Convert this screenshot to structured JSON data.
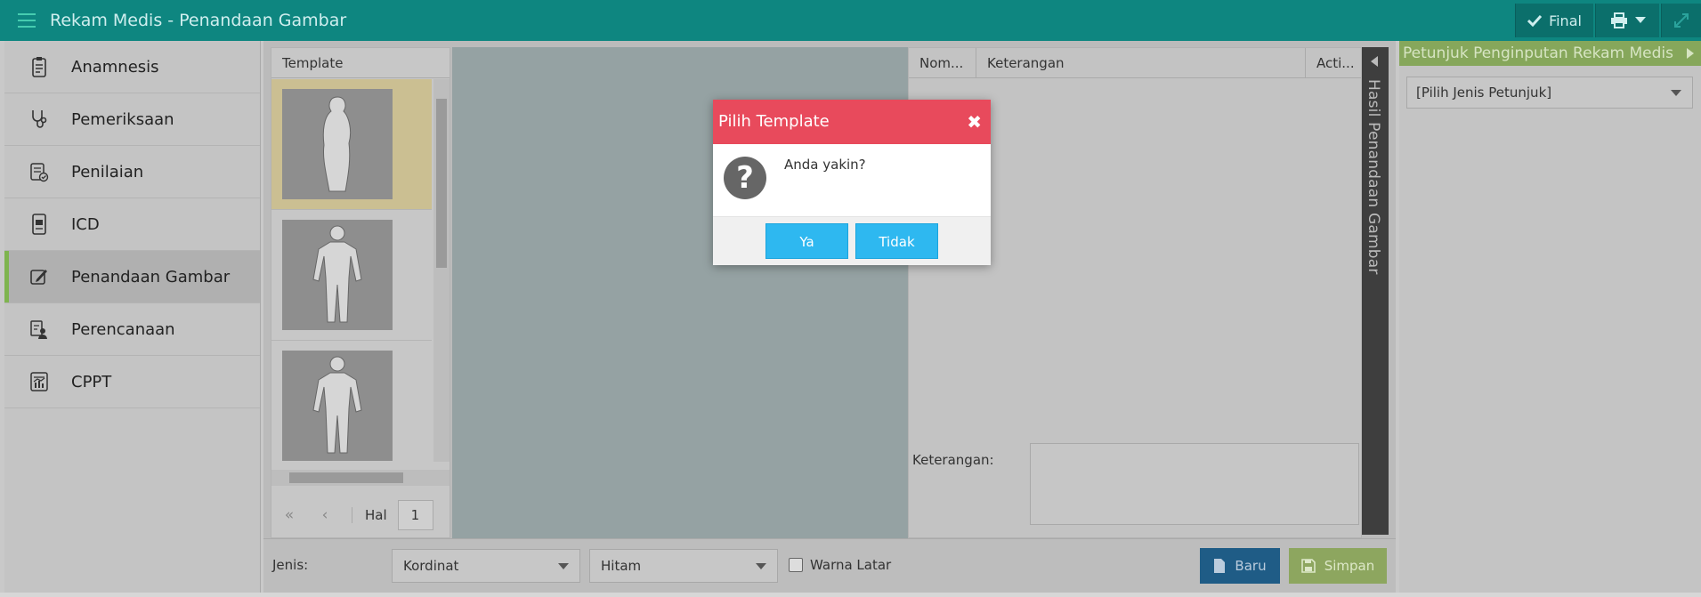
{
  "app": {
    "title": "Rekam Medis - Penandaan Gambar"
  },
  "header": {
    "final_label": "Final"
  },
  "sidebar": {
    "items": [
      {
        "label": "Anamnesis",
        "icon": "clipboard-icon"
      },
      {
        "label": "Pemeriksaan",
        "icon": "stethoscope-icon"
      },
      {
        "label": "Penilaian",
        "icon": "assessment-icon"
      },
      {
        "label": "ICD",
        "icon": "icd-document-icon"
      },
      {
        "label": "Penandaan Gambar",
        "icon": "edit-image-icon",
        "active": true
      },
      {
        "label": "Perencanaan",
        "icon": "planning-icon"
      },
      {
        "label": "CPPT",
        "icon": "chart-report-icon"
      }
    ]
  },
  "template_panel": {
    "header": "Template",
    "pager": {
      "page_label": "Hal",
      "page_value": "1"
    }
  },
  "grid": {
    "columns": [
      "Nom...",
      "Keterangan",
      "Acti..."
    ],
    "keterangan_label": "Keterangan:"
  },
  "side_tab": {
    "label": "Hasil Penandaan Gambar"
  },
  "bottom": {
    "jenis_label": "Jenis:",
    "jenis_value": "Kordinat",
    "color_value": "Hitam",
    "background_label": "Warna Latar",
    "new_label": "Baru",
    "save_label": "Simpan"
  },
  "right_panel": {
    "title": "Petunjuk Penginputan Rekam Medis",
    "select_value": "[Pilih Jenis Petunjuk]"
  },
  "dialog": {
    "title": "Pilih Template",
    "message": "Anda yakin?",
    "yes_label": "Ya",
    "no_label": "Tidak"
  },
  "colors": {
    "header": "#0e8680",
    "dialog_header": "#e84a5c",
    "dialog_button": "#2eb8f0",
    "active_indicator": "#7fb44f",
    "right_panel_header": "#86a75b"
  }
}
